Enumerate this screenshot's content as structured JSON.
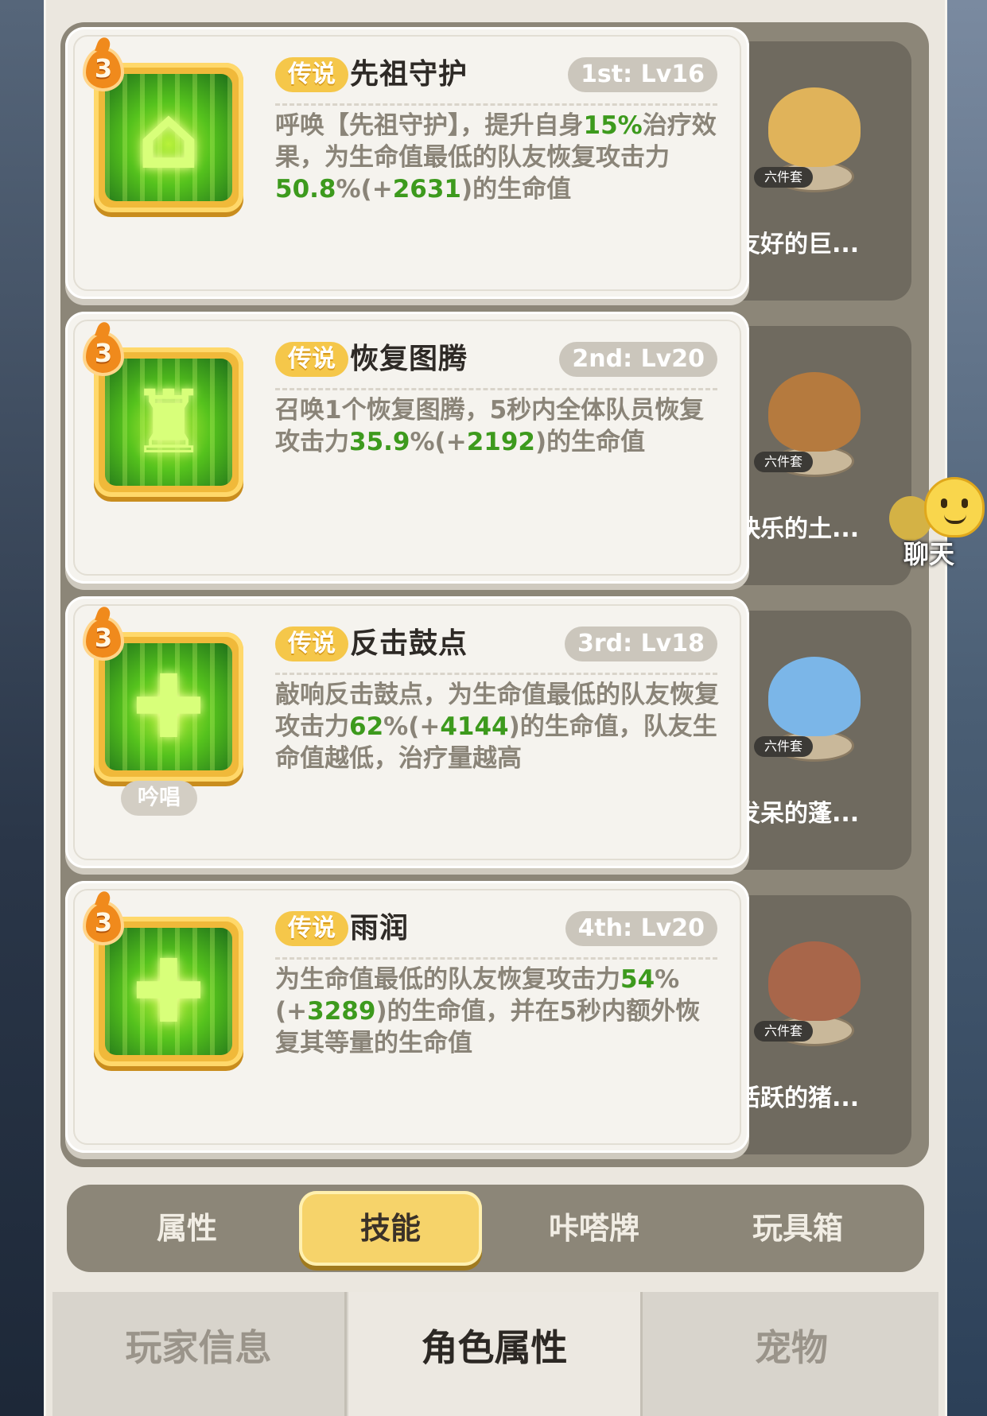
{
  "skills": [
    {
      "level": "3",
      "rarity": "传说",
      "name": "先祖守护",
      "slot": "1st: Lv16",
      "desc": [
        {
          "t": "呼唤【先祖守护】，提升自身",
          "hl": false
        },
        {
          "t": "15%",
          "hl": true
        },
        {
          "t": "治疗效果，为生命值最低的队友恢复攻击力",
          "hl": false
        },
        {
          "t": "50.8",
          "hl": true
        },
        {
          "t": "%(+",
          "hl": false
        },
        {
          "t": "2631",
          "hl": true
        },
        {
          "t": ")的生命值",
          "hl": false
        }
      ],
      "icon": "ancestor-guard-icon",
      "chant": "",
      "pet": {
        "name": "友好的巨...",
        "tag": "六件套",
        "color": "#e0b35a"
      }
    },
    {
      "level": "3",
      "rarity": "传说",
      "name": "恢复图腾",
      "slot": "2nd: Lv20",
      "desc": [
        {
          "t": "召唤1个恢复图腾，5秒内全体队员恢复攻击力",
          "hl": false
        },
        {
          "t": "35.9",
          "hl": true
        },
        {
          "t": "%(+",
          "hl": false
        },
        {
          "t": "2192",
          "hl": true
        },
        {
          "t": ")的生命值",
          "hl": false
        }
      ],
      "icon": "recovery-totem-icon",
      "chant": "",
      "pet": {
        "name": "快乐的土...",
        "tag": "六件套",
        "color": "#b57a3e"
      }
    },
    {
      "level": "3",
      "rarity": "传说",
      "name": "反击鼓点",
      "slot": "3rd: Lv18",
      "desc": [
        {
          "t": "敲响反击鼓点，为生命值最低的队友恢复攻击力",
          "hl": false
        },
        {
          "t": "62",
          "hl": true
        },
        {
          "t": "%(+",
          "hl": false
        },
        {
          "t": "4144",
          "hl": true
        },
        {
          "t": ")的生命值，队友生命值越低，治疗量越高",
          "hl": false
        }
      ],
      "icon": "counter-drum-icon",
      "chant": "吟唱",
      "pet": {
        "name": "发呆的蓬...",
        "tag": "六件套",
        "color": "#7bb6e8"
      }
    },
    {
      "level": "3",
      "rarity": "传说",
      "name": "雨润",
      "slot": "4th: Lv20",
      "desc": [
        {
          "t": "为生命值最低的队友恢复攻击力",
          "hl": false
        },
        {
          "t": "54",
          "hl": true
        },
        {
          "t": "%(+",
          "hl": false
        },
        {
          "t": "3289",
          "hl": true
        },
        {
          "t": ")的生命值，并在5秒内额外恢复其等量的生命值",
          "hl": false
        }
      ],
      "icon": "rain-heal-icon",
      "chant": "",
      "pet": {
        "name": "活跃的猪...",
        "tag": "六件套",
        "color": "#a8664a"
      }
    }
  ],
  "tabs": {
    "attributes": "属性",
    "skills": "技能",
    "cards": "咔嗒牌",
    "toybox": "玩具箱"
  },
  "bottom_tabs": {
    "player_info": "玩家信息",
    "character_attributes": "角色属性",
    "pets": "宠物"
  },
  "chat": {
    "label": "聊天"
  },
  "colors": {
    "rarity_gold": "#f5c74a",
    "highlight_green": "#3d9a1d",
    "active_tab": "#f6d36a"
  }
}
